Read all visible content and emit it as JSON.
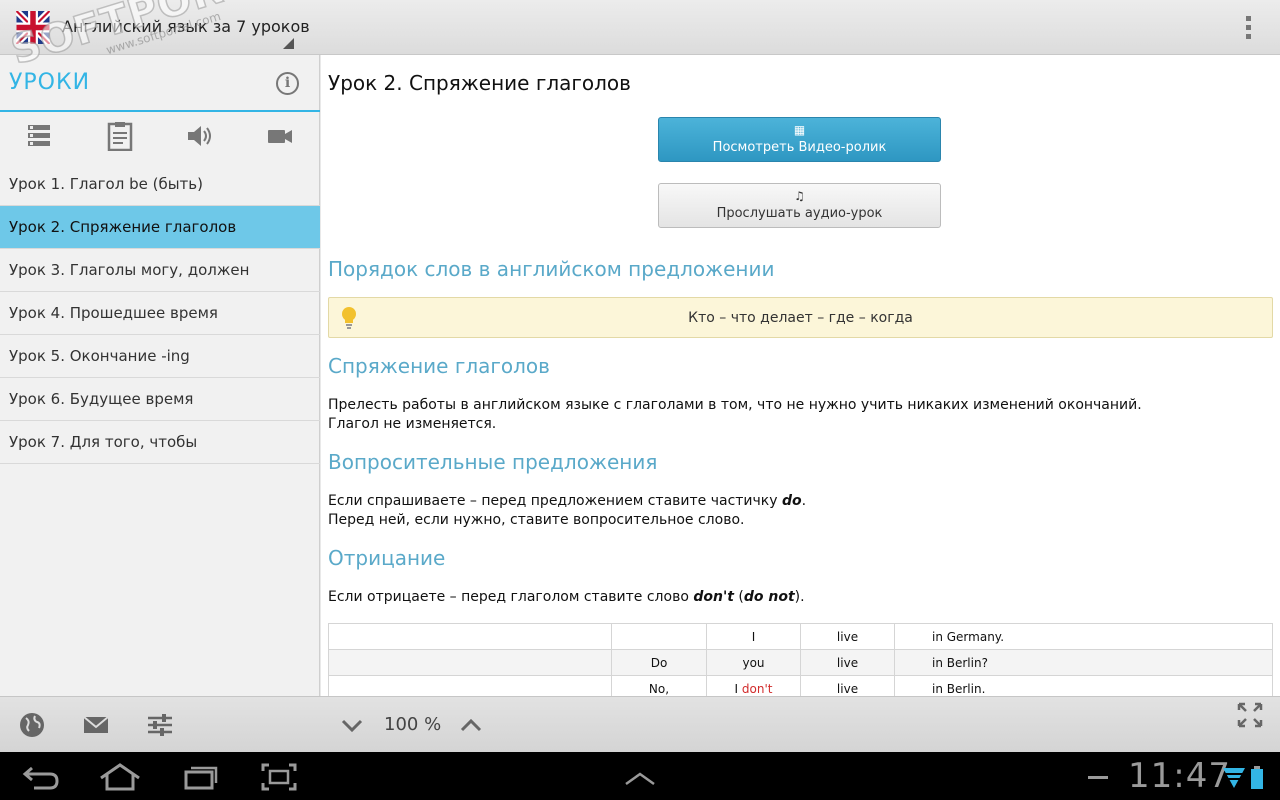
{
  "app": {
    "title": "Английский язык за 7 уроков",
    "watermark": "SOFTPORTAL",
    "watermark_url": "www.softportal.com"
  },
  "sidebar": {
    "title": "УРОКИ",
    "tabs": [
      "list-icon",
      "notes-icon",
      "speaker-icon",
      "video-camera-icon"
    ],
    "items": [
      {
        "label": "Урок 1. Глагол be (быть)",
        "active": false
      },
      {
        "label": "Урок 2. Спряжение глаголов",
        "active": true
      },
      {
        "label": "Урок 3. Глаголы могу, должен",
        "active": false
      },
      {
        "label": "Урок 4. Прошедшее время",
        "active": false
      },
      {
        "label": "Урок 5. Окончание -ing",
        "active": false
      },
      {
        "label": "Урок 6. Будущее время",
        "active": false
      },
      {
        "label": "Урок 7. Для того, чтобы",
        "active": false
      }
    ]
  },
  "content": {
    "lesson_title": "Урок 2. Спряжение глаголов",
    "video_button": "Посмотреть Видео-ролик",
    "audio_button": "Прослушать аудио-урок",
    "section1_title": "Порядок слов в английском предложении",
    "tip_text": "Кто – что делает – где – когда",
    "section2_title": "Спряжение глаголов",
    "section2_line1": "Прелесть работы в английском языке с глаголами в том, что не нужно учить никаких изменений окончаний.",
    "section2_line2": "Глагол не изменяется.",
    "section3_title": "Вопросительные предложения",
    "section3_line1_pre": "Если спрашиваете – перед предложением ставите частичку ",
    "section3_line1_em": "do",
    "section3_line1_post": ".",
    "section3_line2": "Перед ней, если нужно, ставите вопросительное слово.",
    "section4_title": "Отрицание",
    "section4_pre": "Если отрицаете – перед глаголом ставите слово ",
    "section4_em1": "don't",
    "section4_mid": " (",
    "section4_em2": "do not",
    "section4_post": ").",
    "table": [
      [
        "",
        "",
        "I",
        "live",
        "in Germany."
      ],
      [
        "",
        "Do",
        "you",
        "live",
        "in Berlin?"
      ],
      [
        "",
        "No,",
        "I",
        "live",
        "in Berlin."
      ]
    ],
    "table_neg_word": "don't"
  },
  "toolbar": {
    "zoom": "100 %"
  },
  "system": {
    "clock": "11:47"
  }
}
